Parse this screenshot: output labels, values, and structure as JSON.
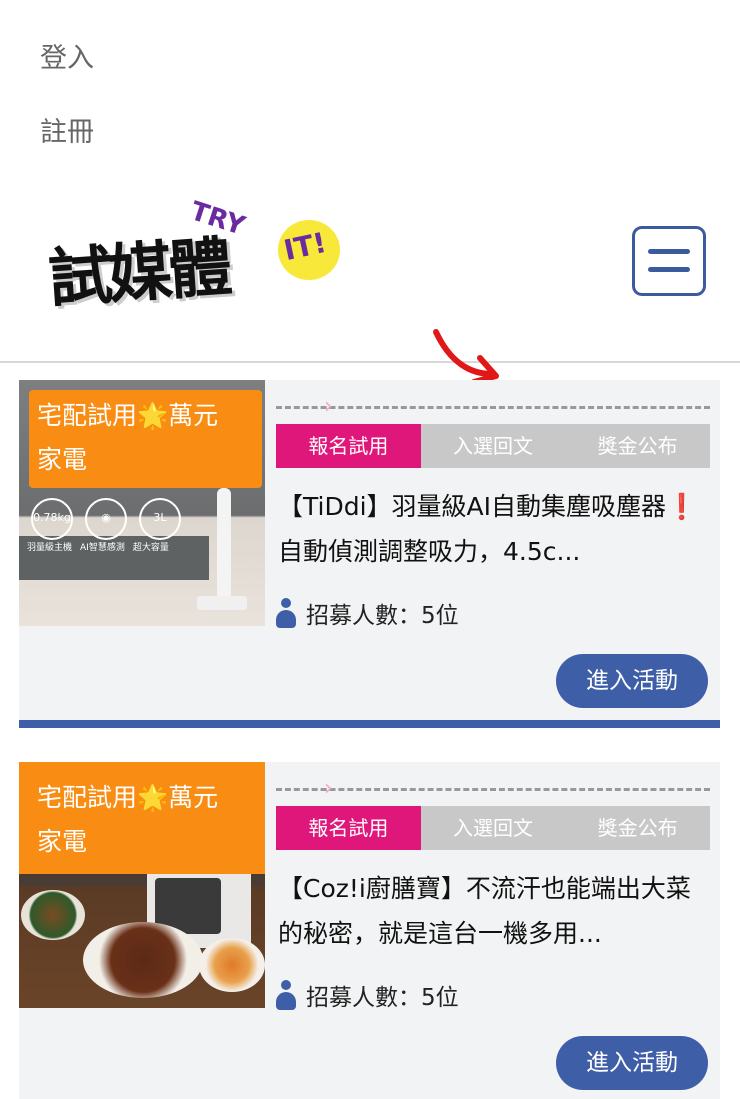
{
  "nav": {
    "login": "登入",
    "register": "註冊"
  },
  "logo": {
    "cn": "試媒體",
    "try": "TRY",
    "it": "IT!"
  },
  "menu": {
    "icon": "hamburger-icon"
  },
  "colors": {
    "brand_blue": "#3e5ea8",
    "active_tab": "#e0177a",
    "badge": "#f98c12",
    "inactive_tab": "#c8c8c8"
  },
  "cards": [
    {
      "badge": {
        "line1_prefix": "宅配試用",
        "star": "🌟",
        "line1_suffix": "萬元",
        "line2": "家電"
      },
      "image_text": {
        "icon1": "0.78kg",
        "icon3": "3L",
        "label1": "羽量級主機",
        "label2": "AI智慧感測",
        "label3": "超大容量"
      },
      "tabs": [
        "報名試用",
        "入選回文",
        "獎金公布"
      ],
      "title_a": "【TiDdi】羽量級AI自動集塵吸塵器",
      "title_ex": "❗",
      "title_b": "自動偵測調整吸力，4.5c...",
      "recruit": "招募人數：5位",
      "cta": "進入活動"
    },
    {
      "badge": {
        "line1_prefix": "宅配試用",
        "star": "🌟",
        "line1_suffix": "萬元",
        "line2": "家電"
      },
      "tabs": [
        "報名試用",
        "入選回文",
        "獎金公布"
      ],
      "title_a": "【Coz!i廚膳寶】不流汗也能端出大菜的秘密，就是這台一機多用...",
      "recruit": "招募人數：5位",
      "cta": "進入活動"
    }
  ]
}
